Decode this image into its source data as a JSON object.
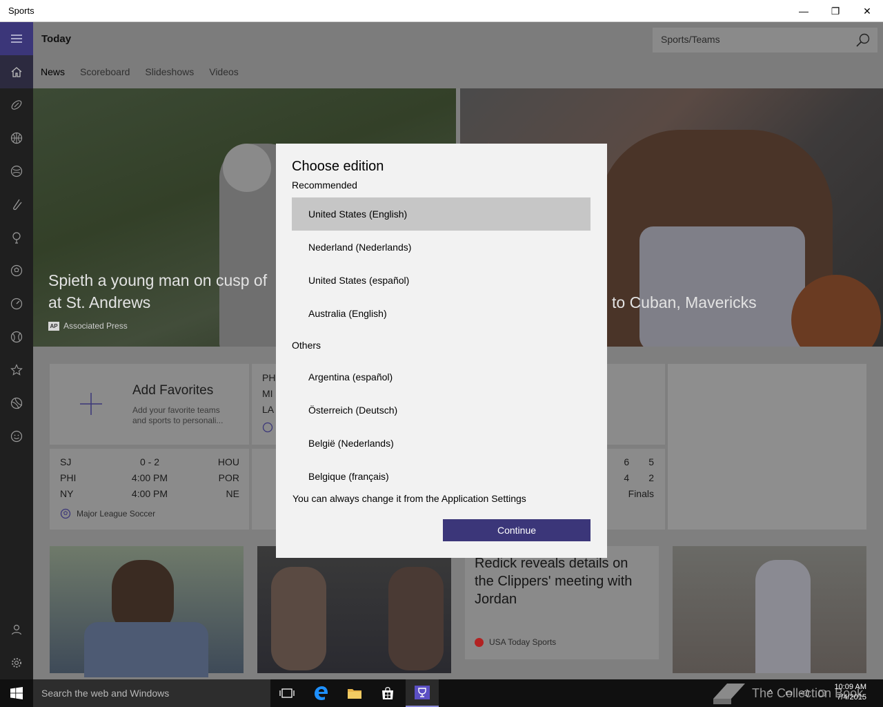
{
  "window": {
    "title": "Sports",
    "minimize_glyph": "—",
    "restore_glyph": "❐",
    "close_glyph": "✕"
  },
  "rail": {
    "icons": [
      "hamburger-menu-icon",
      "home-icon",
      "football-icon",
      "basketball-icon",
      "baseball-icon",
      "hockey-icon",
      "golf-icon",
      "soccer-icon",
      "racing-icon",
      "tennis-icon",
      "favorites-star-icon",
      "more-sports-icon",
      "fun-face-icon",
      "account-icon",
      "settings-gear-icon"
    ]
  },
  "header": {
    "title": "Today",
    "search_placeholder": "Sports/Teams",
    "tabs": [
      {
        "label": "News",
        "selected": true
      },
      {
        "label": "Scoreboard",
        "selected": false
      },
      {
        "label": "Slideshows",
        "selected": false
      },
      {
        "label": "Videos",
        "selected": false
      }
    ]
  },
  "hero": {
    "left_caption_line1": "Spieth a young man on cusp of",
    "left_caption_line2": "at St. Andrews",
    "left_source_logo": "AP",
    "left_source": "Associated Press",
    "right_caption": "to Cuban, Mavericks"
  },
  "favorites_tile": {
    "title": "Add Favorites",
    "description": "Add your favorite teams and sports to personali..."
  },
  "scores_mls": {
    "rows": [
      {
        "home": "SJ",
        "mid": "0  -  2",
        "away": "HOU"
      },
      {
        "home": "PHI",
        "mid": "4:00 PM",
        "away": "POR"
      },
      {
        "home": "NY",
        "mid": "4:00 PM",
        "away": "NE"
      }
    ],
    "league": "Major League Soccer"
  },
  "partial_scores": {
    "left_abbrevs": [
      "PH",
      "MI",
      "LA"
    ],
    "right_values": [
      [
        "6",
        "5"
      ],
      [
        "4",
        "2"
      ]
    ],
    "right_status": "Finals"
  },
  "article": {
    "headline": "Redick reveals details on the Clippers' meeting with Jordan",
    "source": "USA Today Sports"
  },
  "dialog": {
    "title": "Choose edition",
    "recommended_label": "Recommended",
    "recommended": [
      {
        "label": "United States (English)",
        "selected": true
      },
      {
        "label": "Nederland (Nederlands)",
        "selected": false
      },
      {
        "label": "United States (español)",
        "selected": false
      },
      {
        "label": "Australia (English)",
        "selected": false
      }
    ],
    "others_label": "Others",
    "others": [
      {
        "label": "Argentina (español)"
      },
      {
        "label": "Österreich (Deutsch)"
      },
      {
        "label": "België (Nederlands)"
      },
      {
        "label": "Belgique (français)"
      }
    ],
    "note": "You can always change it from the Application Settings",
    "continue_label": "Continue"
  },
  "taskbar": {
    "search_text": "Search the web and Windows",
    "time": "10:09 AM",
    "date": "7/4/2015",
    "watermark": "The Collection Book"
  },
  "colors": {
    "accent": "#3b3679",
    "dialog_bg": "#f2f2f2",
    "selected_option": "#c6c6c6"
  }
}
